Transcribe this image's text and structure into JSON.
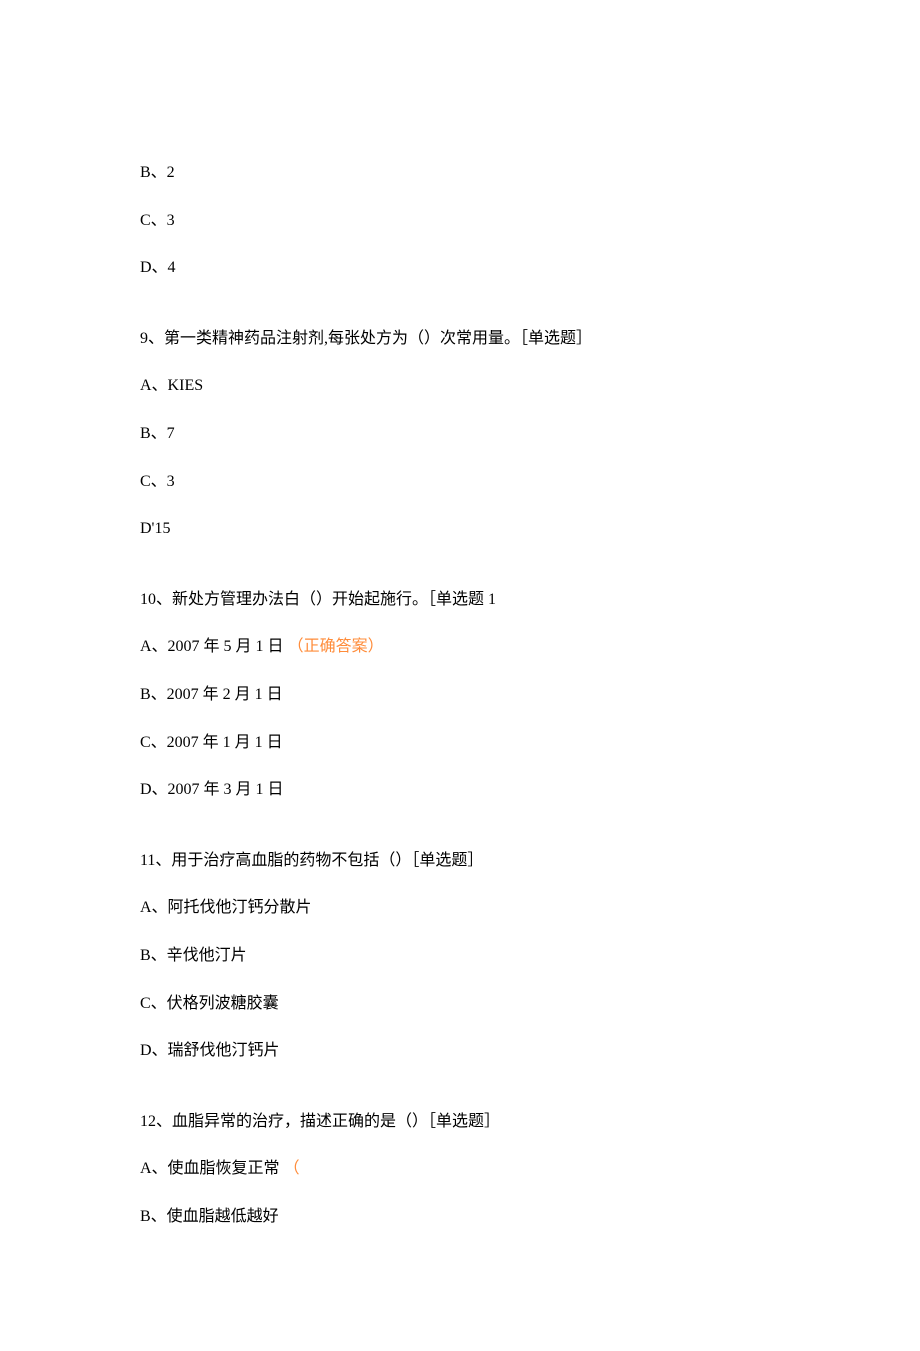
{
  "lines": {
    "l1": "B、2",
    "l2": "C、3",
    "l3": "D、4",
    "q9": "9、第一类精神药品注射剂,每张处方为（）次常用量。［单选题］",
    "q9a": "A、KIES",
    "q9b": "B、7",
    "q9c": "C、3",
    "q9d": "D'15",
    "q10": "10、新处方管理办法白（）开始起施行。［单选题 1",
    "q10a_text": "A、2007 年 5 月 1 日",
    "q10a_correct": "（正确答案）",
    "q10b": "B、2007 年 2 月 1 日",
    "q10c": "C、2007 年 1 月 1 日",
    "q10d": "D、2007 年 3 月 1 日",
    "q11": "11、用于治疗高血脂的药物不包括（）［单选题］",
    "q11a": "A、阿托伐他汀钙分散片",
    "q11b": "B、辛伐他汀片",
    "q11c": "C、伏格列波糖胶囊",
    "q11d": "D、瑞舒伐他汀钙片",
    "q12": "12、血脂异常的治疗，描述正确的是（）［单选题］",
    "q12a_text": "A、使血脂恢复正常",
    "q12a_paren": "（",
    "q12b": "B、使血脂越低越好"
  }
}
